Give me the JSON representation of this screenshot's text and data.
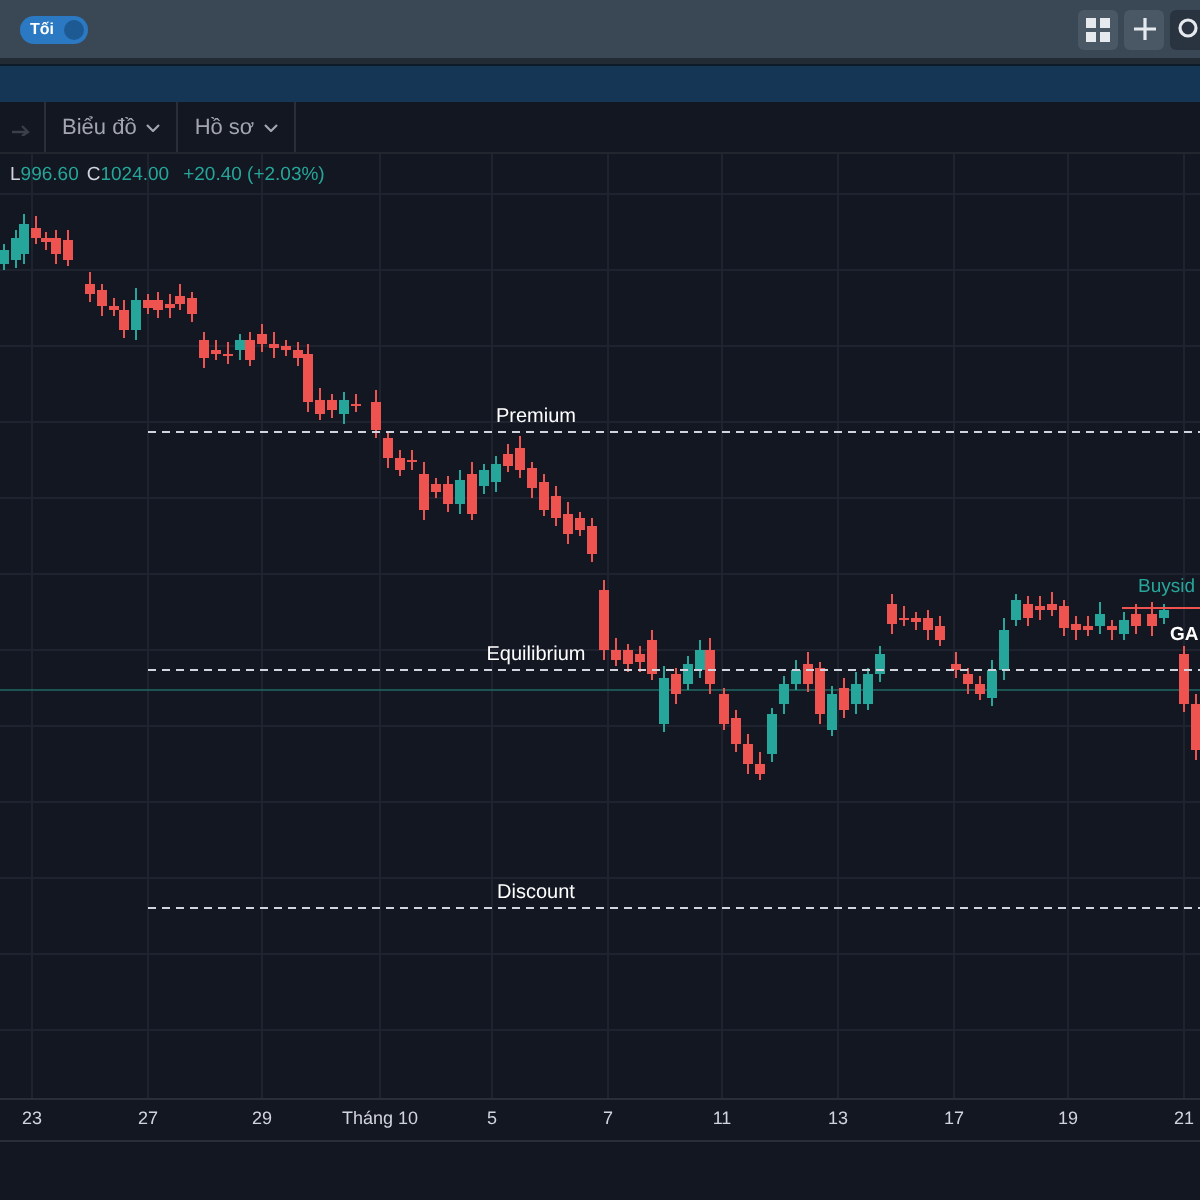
{
  "header": {
    "theme_toggle": {
      "label": "Tối",
      "on": true
    }
  },
  "toolbar": {
    "menus": [
      {
        "label": "Biểu đồ"
      },
      {
        "label": "Hồ sơ"
      }
    ]
  },
  "legend": {
    "low_label": "L",
    "low": "996.60",
    "close_label": "C",
    "close": "1024.00",
    "change": "+20.40 (+2.03%)"
  },
  "levels": [
    {
      "label": "Premium"
    },
    {
      "label": "Equilibrium"
    },
    {
      "label": "Discount"
    }
  ],
  "markers": [
    {
      "kind": "liquidity",
      "label": "Buysid"
    },
    {
      "kind": "gap",
      "label": "GA"
    }
  ],
  "x_axis": {
    "labels": [
      "23",
      "27",
      "29",
      "Tháng 10",
      "5",
      "7",
      "11",
      "13",
      "17",
      "19",
      "21"
    ]
  }
}
